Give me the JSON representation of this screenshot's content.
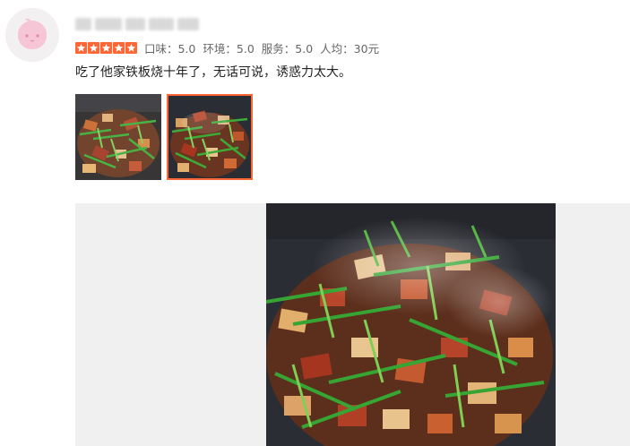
{
  "review": {
    "avatar_icon": "peach-avatar-icon",
    "username_blurred": true,
    "rating": {
      "stars": 5,
      "star_color": "#ff6633",
      "taste": "口味：5.0",
      "environment": "环境：5.0",
      "service": "服务：5.0",
      "average_price": "人均：30元"
    },
    "text": "吃了他家铁板烧十年了，无话可说，诱惑力太大。",
    "photos": [
      {
        "name": "photo-thumbnail-1",
        "selected": false
      },
      {
        "name": "photo-thumbnail-2",
        "selected": true
      }
    ],
    "accent_color": "#ff6633"
  }
}
